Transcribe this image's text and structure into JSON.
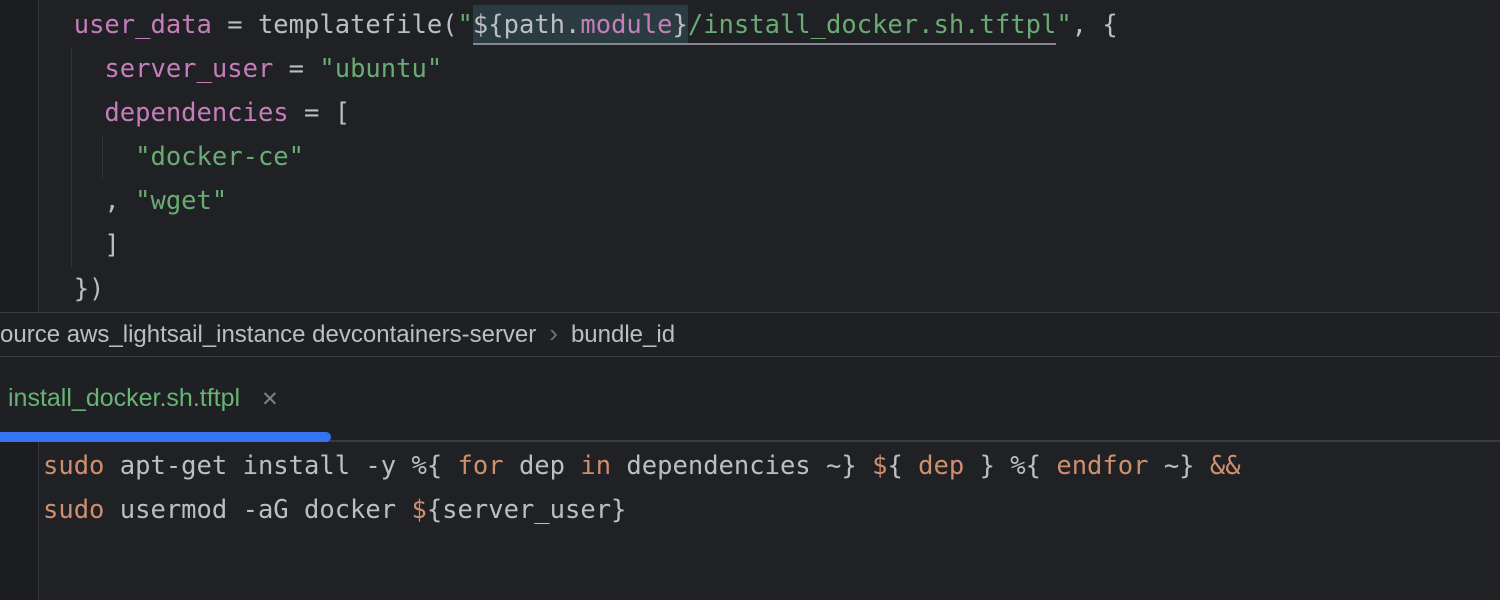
{
  "colors": {
    "accent_blue": "#3574f0",
    "string_green": "#6aab73",
    "keyword_orange": "#cf8e6d",
    "property_pink": "#c77dbb",
    "default_text": "#bcbec4",
    "tab_green": "#67b474",
    "highlight_box": "#2a3b41",
    "editor_bg": "#1f2124"
  },
  "breadcrumbs": {
    "left": "ource aws_lightsail_instance devcontainers-server",
    "chevron": "›",
    "current": "bundle_id"
  },
  "tab": {
    "label": "install_docker.sh.tftpl",
    "close_glyph": "✕"
  },
  "editors": {
    "terraform": {
      "lines": [
        {
          "tokens": [
            {
              "t": "  ",
              "c": "txt"
            },
            {
              "t": "user_data",
              "c": "prop"
            },
            {
              "t": " = templatefile(",
              "c": "txt"
            },
            {
              "t": "\"",
              "c": "str"
            },
            {
              "t": "${path.",
              "c": "txt hl u"
            },
            {
              "t": "module",
              "c": "prop hl u"
            },
            {
              "t": "}",
              "c": "txt hl u"
            },
            {
              "t": "/install_docker.sh.tftpl",
              "c": "str u"
            },
            {
              "t": "\"",
              "c": "str"
            },
            {
              "t": ", {",
              "c": "txt"
            }
          ]
        },
        {
          "tokens": [
            {
              "t": "    ",
              "c": "txt"
            },
            {
              "t": "server_user",
              "c": "prop"
            },
            {
              "t": " = ",
              "c": "txt"
            },
            {
              "t": "\"ubuntu\"",
              "c": "str"
            }
          ]
        },
        {
          "tokens": [
            {
              "t": "    ",
              "c": "txt"
            },
            {
              "t": "dependencies",
              "c": "prop"
            },
            {
              "t": " = [",
              "c": "txt"
            }
          ]
        },
        {
          "tokens": [
            {
              "t": "      ",
              "c": "txt"
            },
            {
              "t": "\"docker-ce\"",
              "c": "str"
            }
          ]
        },
        {
          "tokens": [
            {
              "t": "    , ",
              "c": "txt"
            },
            {
              "t": "\"wget\"",
              "c": "str"
            }
          ]
        },
        {
          "tokens": [
            {
              "t": "    ]",
              "c": "txt"
            }
          ]
        },
        {
          "tokens": [
            {
              "t": "  })",
              "c": "txt"
            }
          ]
        }
      ]
    },
    "template": {
      "lines": [
        {
          "tokens": [
            {
              "t": "sudo",
              "c": "kw"
            },
            {
              "t": " apt-get install -y %{ ",
              "c": "txt"
            },
            {
              "t": "for",
              "c": "kw"
            },
            {
              "t": " dep ",
              "c": "txt"
            },
            {
              "t": "in",
              "c": "kw"
            },
            {
              "t": " dependencies ~} ",
              "c": "txt"
            },
            {
              "t": "$",
              "c": "kw"
            },
            {
              "t": "{ ",
              "c": "txt"
            },
            {
              "t": "dep",
              "c": "kw"
            },
            {
              "t": " } %{ ",
              "c": "txt"
            },
            {
              "t": "endfor",
              "c": "kw"
            },
            {
              "t": " ~} ",
              "c": "txt"
            },
            {
              "t": "&&",
              "c": "kw"
            }
          ]
        },
        {
          "tokens": [
            {
              "t": "sudo",
              "c": "kw"
            },
            {
              "t": " usermod -aG docker ",
              "c": "txt"
            },
            {
              "t": "$",
              "c": "kw"
            },
            {
              "t": "{server_user}",
              "c": "txt"
            }
          ]
        }
      ]
    }
  }
}
